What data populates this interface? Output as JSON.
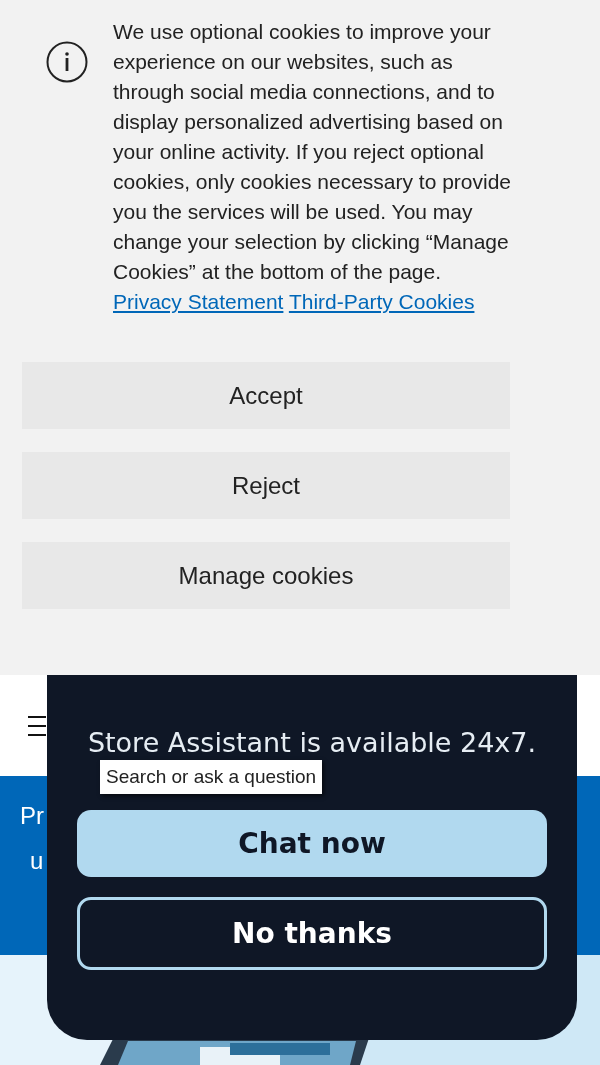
{
  "cookie_banner": {
    "message": "We use optional cookies to improve your experience on our websites, such as through social media connections, and to display personalized advertising based on your online activity. If you reject optional cookies, only cookies necessary to provide you the services will be used. You may change your selection by clicking “Manage Cookies” at the bottom of the page.",
    "links": [
      "Privacy Statement",
      "Third-Party Cookies"
    ],
    "buttons": [
      "Accept",
      "Reject",
      "Manage cookies"
    ]
  },
  "page": {
    "banner_text": [
      "Pr",
      "u"
    ],
    "hero": {
      "kind": "picture"
    }
  },
  "chat_dialog": {
    "subtitle": "Store Assistant is available 24x7.",
    "tooltip": "Search or ask a question",
    "buttons": [
      {
        "label": "Chat now",
        "kind": "primary"
      },
      {
        "label": "No thanks",
        "kind": "secondary"
      }
    ]
  }
}
